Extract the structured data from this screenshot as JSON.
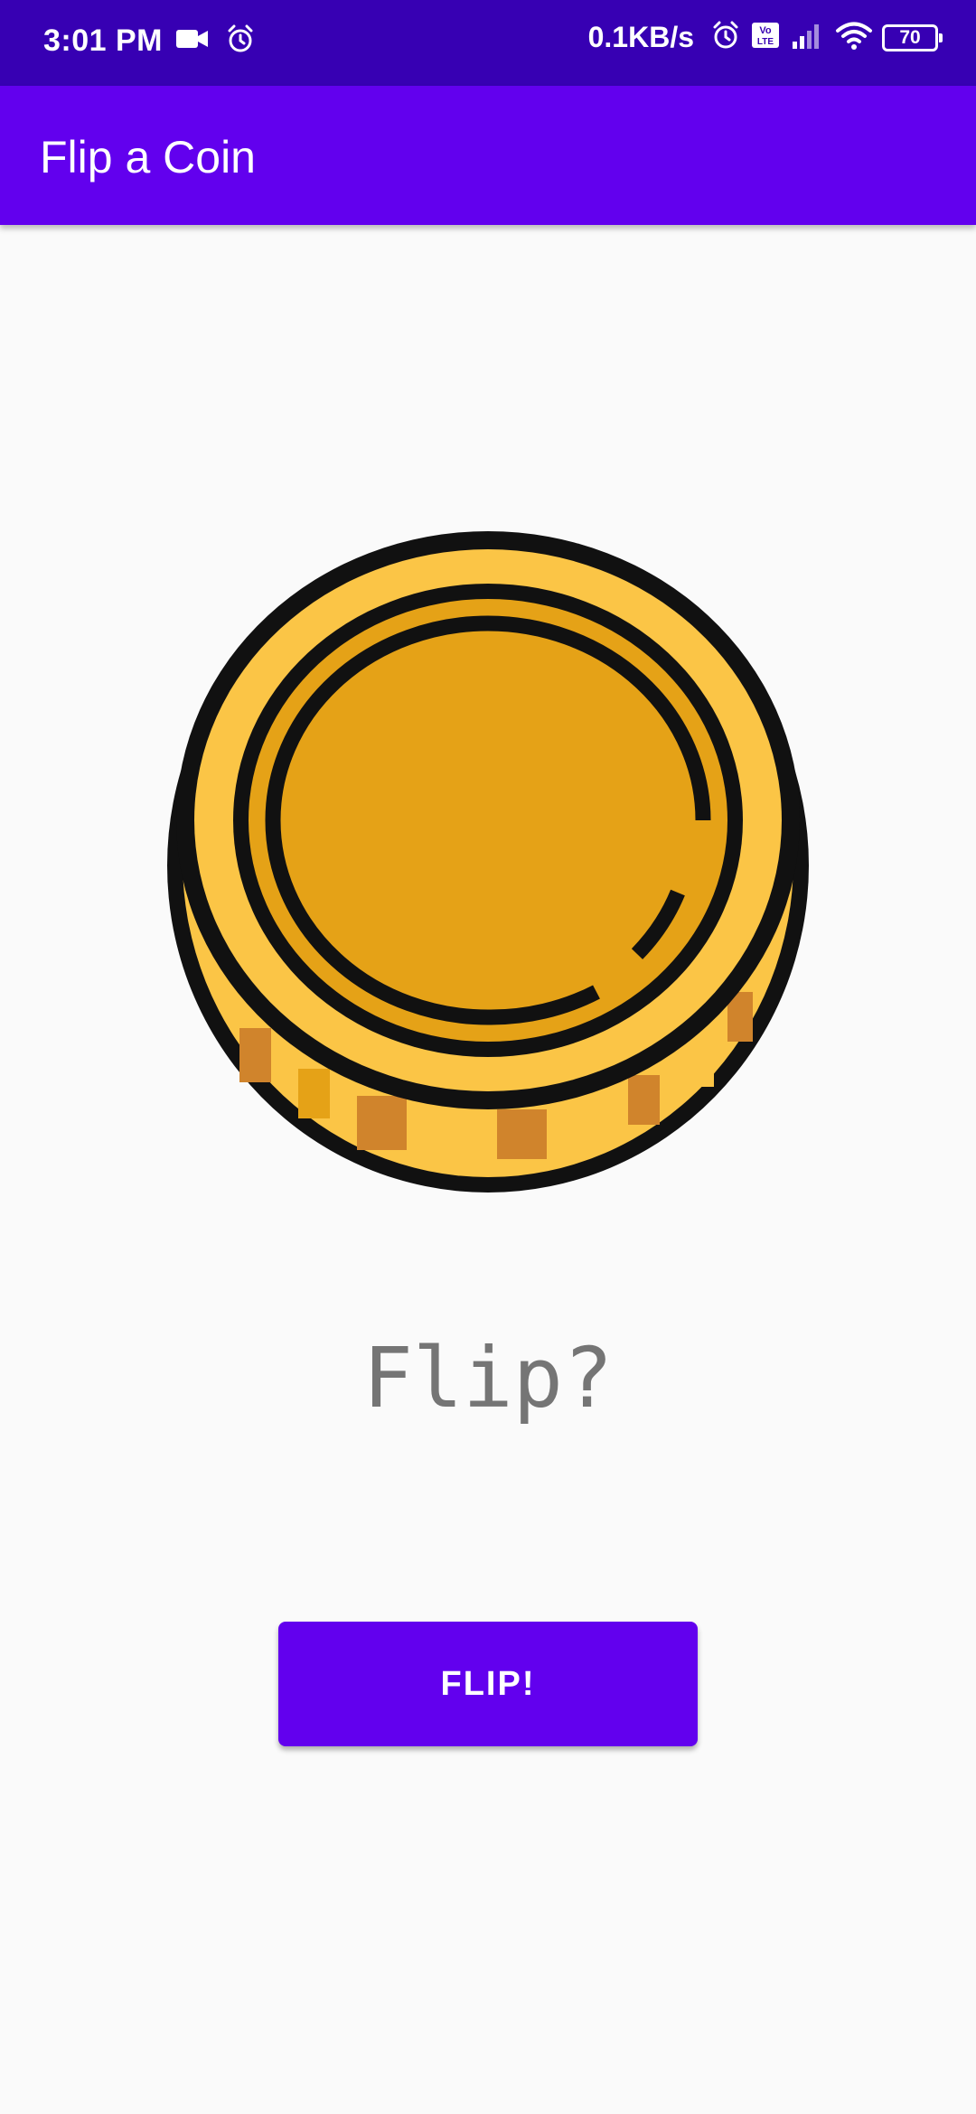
{
  "status_bar": {
    "time": "3:01 PM",
    "net_speed": "0.1KB/s",
    "battery_level": "70",
    "volte_label": "Vo LTE",
    "icons": [
      "video-camera-icon",
      "alarm-icon",
      "alarm-icon",
      "volte-icon",
      "signal-icon",
      "wifi-icon",
      "battery-icon"
    ]
  },
  "app_bar": {
    "title": "Flip a Coin"
  },
  "main": {
    "coin_icon": "coin-icon",
    "result_text": "Flip?",
    "flip_button_label": "FLIP!"
  },
  "colors": {
    "status_bar": "#3700b3",
    "primary": "#6200ee",
    "background": "#fafafa",
    "coin_face": "#fbc546",
    "coin_inner": "#e5a217",
    "coin_edge_dark": "#d0842c",
    "outline": "#111111",
    "result_text": "#757575"
  }
}
